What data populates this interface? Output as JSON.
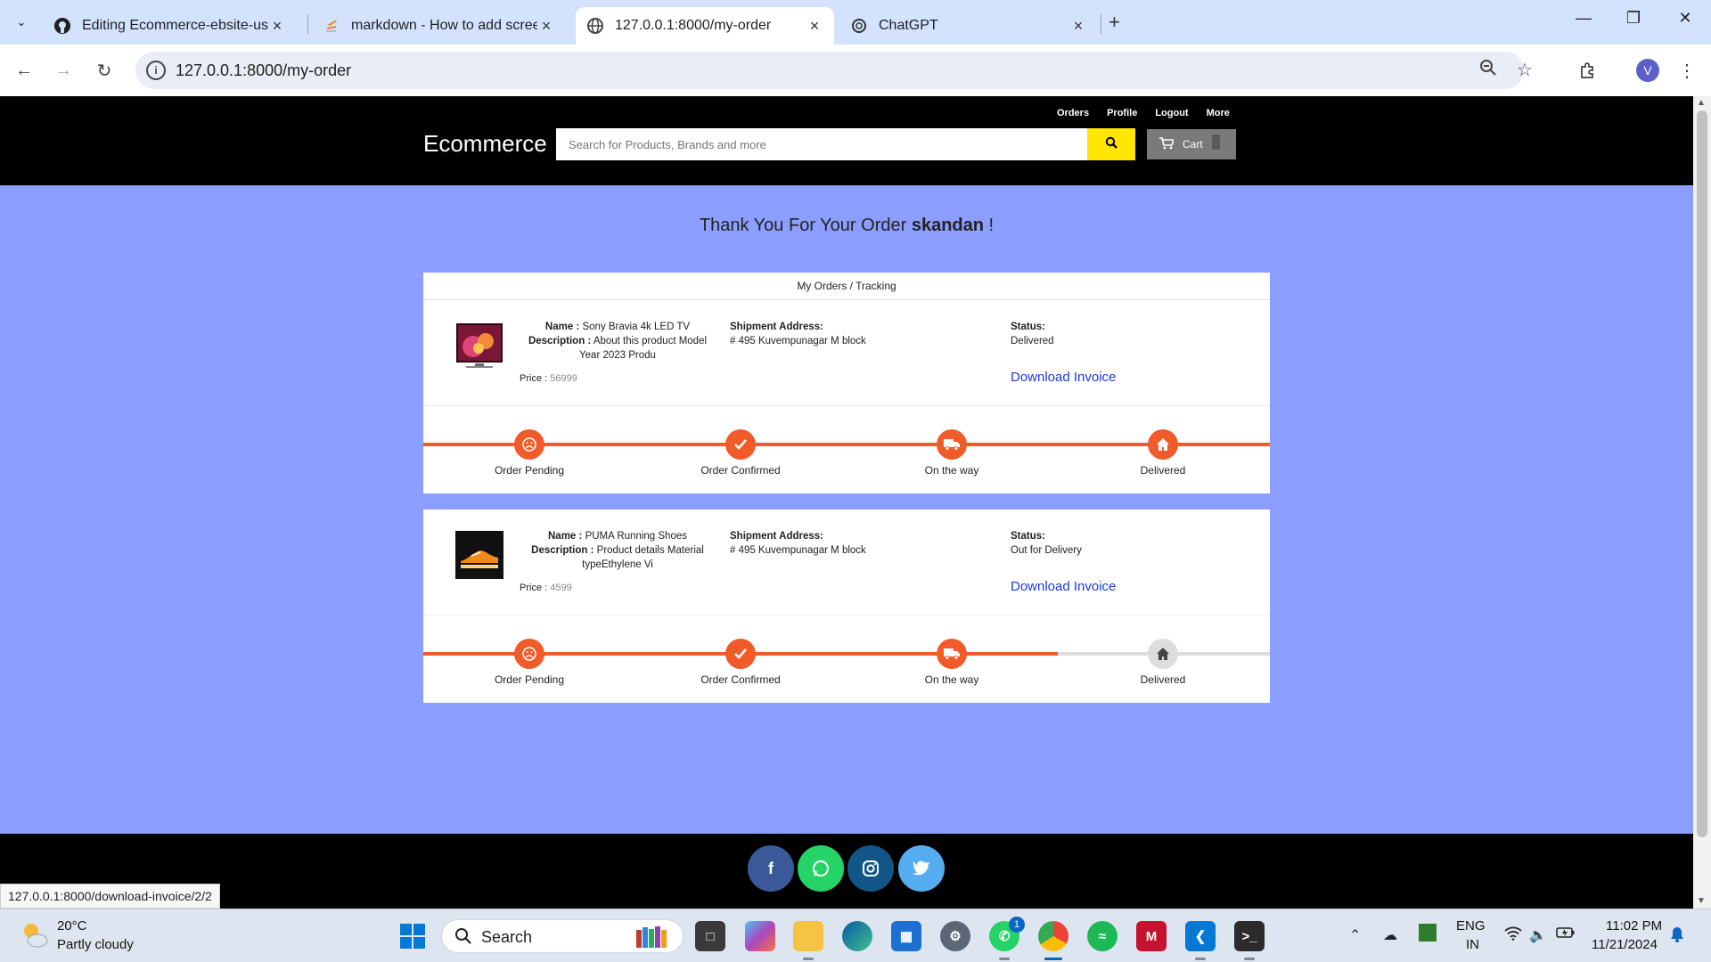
{
  "browser": {
    "tabs": [
      {
        "title": "Editing Ecommerce-ebsite-using",
        "icon": "github-icon"
      },
      {
        "title": "markdown - How to add screen",
        "icon": "stackoverflow-icon"
      },
      {
        "title": "127.0.0.1:8000/my-order",
        "icon": "globe-icon"
      },
      {
        "title": "ChatGPT",
        "icon": "chatgpt-icon"
      }
    ],
    "url": "127.0.0.1:8000/my-order",
    "profile_initial": "V"
  },
  "site": {
    "brand": "Ecommerce",
    "top_links": [
      "Orders",
      "Profile",
      "Logout",
      "More"
    ],
    "search_placeholder": "Search for Products, Brands and more",
    "cart_label": "Cart"
  },
  "thank_you": {
    "prefix": "Thank You For Your Order",
    "user": "skandan",
    "suffix": "!"
  },
  "orders_heading": "My Orders / Tracking",
  "labels": {
    "name": "Name :",
    "description": "Description :",
    "price": "Price :",
    "shipment": "Shipment Address:",
    "status": "Status:",
    "download": "Download Invoice"
  },
  "steps": [
    "Order Pending",
    "Order Confirmed",
    "On the way",
    "Delivered"
  ],
  "orders": [
    {
      "name": "Sony Bravia 4k LED TV",
      "description": "About this product Model Year 2023 Produ",
      "price": "56999",
      "address": "# 495 Kuvempunagar M block",
      "status": "Delivered",
      "progress_steps_done": 4
    },
    {
      "name": "PUMA Running Shoes",
      "description": "Product details Material typeEthylene Vi",
      "price": "4599",
      "address": "# 495 Kuvempunagar M block",
      "status": "Out for Delivery",
      "progress_steps_done": 3
    }
  ],
  "hover_status_url": "127.0.0.1:8000/download-invoice/2/2",
  "taskbar": {
    "weather_temp": "20°C",
    "weather_desc": "Partly cloudy",
    "search_label": "Search",
    "lang": "ENG",
    "region": "IN",
    "time": "11:02 PM",
    "date": "11/21/2024",
    "whatsapp_badge": "1"
  },
  "colors": {
    "accent": "#f15a29",
    "page_bg": "#8c9eff",
    "link": "#1c39d8",
    "search_btn": "#ffe500"
  }
}
